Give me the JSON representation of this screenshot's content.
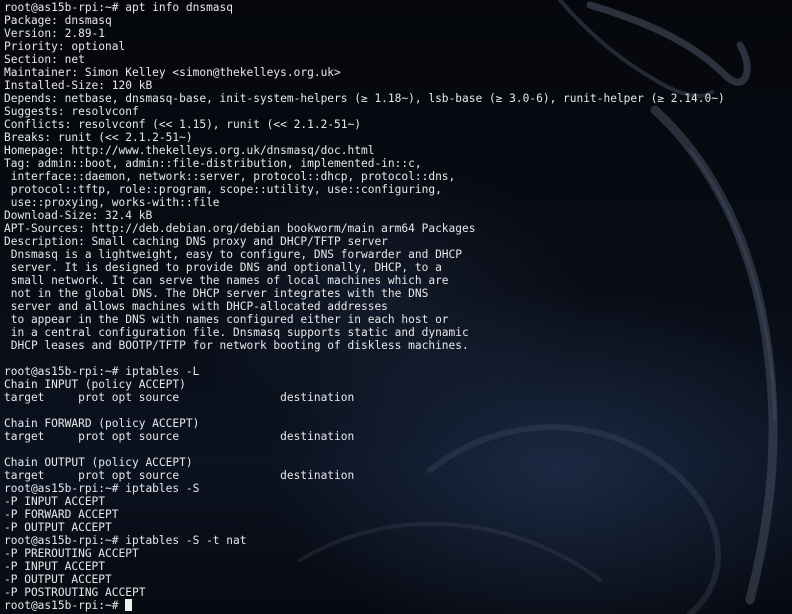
{
  "terminal": {
    "lines": [
      "root@as15b-rpi:~# apt info dnsmasq",
      "Package: dnsmasq",
      "Version: 2.89-1",
      "Priority: optional",
      "Section: net",
      "Maintainer: Simon Kelley <simon@thekelleys.org.uk>",
      "Installed-Size: 120 kB",
      "Depends: netbase, dnsmasq-base, init-system-helpers (≥ 1.18~), lsb-base (≥ 3.0-6), runit-helper (≥ 2.14.0~)",
      "Suggests: resolvconf",
      "Conflicts: resolvconf (<< 1.15), runit (<< 2.1.2-51~)",
      "Breaks: runit (<< 2.1.2-51~)",
      "Homepage: http://www.thekelleys.org.uk/dnsmasq/doc.html",
      "Tag: admin::boot, admin::file-distribution, implemented-in::c,",
      " interface::daemon, network::server, protocol::dhcp, protocol::dns,",
      " protocol::tftp, role::program, scope::utility, use::configuring,",
      " use::proxying, works-with::file",
      "Download-Size: 32.4 kB",
      "APT-Sources: http://deb.debian.org/debian bookworm/main arm64 Packages",
      "Description: Small caching DNS proxy and DHCP/TFTP server",
      " Dnsmasq is a lightweight, easy to configure, DNS forwarder and DHCP",
      " server. It is designed to provide DNS and optionally, DHCP, to a",
      " small network. It can serve the names of local machines which are",
      " not in the global DNS. The DHCP server integrates with the DNS",
      " server and allows machines with DHCP-allocated addresses",
      " to appear in the DNS with names configured either in each host or",
      " in a central configuration file. Dnsmasq supports static and dynamic",
      " DHCP leases and BOOTP/TFTP for network booting of diskless machines.",
      "",
      "root@as15b-rpi:~# iptables -L",
      "Chain INPUT (policy ACCEPT)",
      "target     prot opt source               destination",
      "",
      "Chain FORWARD (policy ACCEPT)",
      "target     prot opt source               destination",
      "",
      "Chain OUTPUT (policy ACCEPT)",
      "target     prot opt source               destination",
      "root@as15b-rpi:~# iptables -S",
      "-P INPUT ACCEPT",
      "-P FORWARD ACCEPT",
      "-P OUTPUT ACCEPT",
      "root@as15b-rpi:~# iptables -S -t nat",
      "-P PREROUTING ACCEPT",
      "-P INPUT ACCEPT",
      "-P OUTPUT ACCEPT",
      "-P POSTROUTING ACCEPT"
    ],
    "prompt": "root@as15b-rpi:~# ",
    "colors": {
      "background": "#06090f",
      "foreground": "#e8e8e8",
      "cursor": "#f0f0f0",
      "wallpaper_dragon": "#4a5466"
    },
    "wallpaper": "kali-dragon-logo"
  }
}
